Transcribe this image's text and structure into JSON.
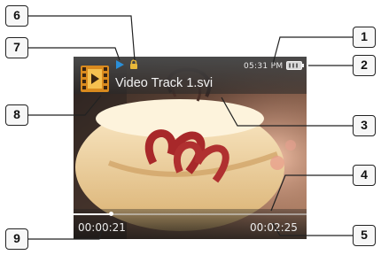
{
  "status_bar": {
    "time": "05:31 PM",
    "play_state_icon": "play-icon",
    "lock_icon": "lock-icon",
    "battery_icon": "battery-icon"
  },
  "file": {
    "type_icon": "video-file-icon",
    "title": "Video Track 1.svi"
  },
  "playback": {
    "elapsed": "00:00:21",
    "total": "00:02:25",
    "progress_fraction": 0.16
  },
  "callouts": [
    "1",
    "2",
    "3",
    "4",
    "5",
    "6",
    "7",
    "8",
    "9"
  ],
  "colors": {
    "overlay_text": "#f2f2f2",
    "play_indicator": "#2a8fd8",
    "lock_indicator": "#e8b83a",
    "callout_border": "#222222"
  }
}
